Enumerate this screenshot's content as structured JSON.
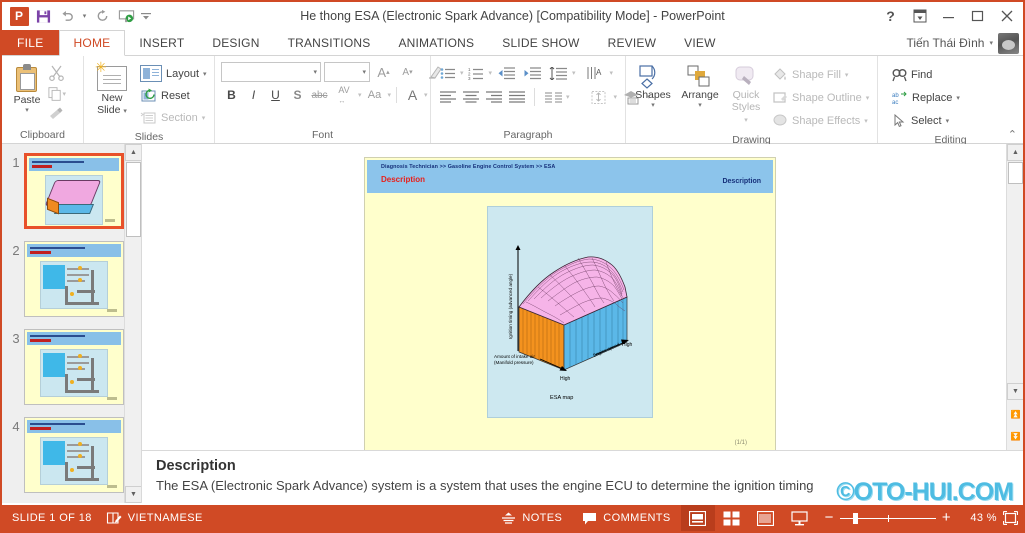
{
  "window": {
    "title": "He thong ESA (Electronic Spark Advance) [Compatibility Mode] - PowerPoint",
    "help_icon": "?",
    "ribbon_display_icon": "ribbon-display-options-icon",
    "minimize_icon": "minimize-icon",
    "restore_icon": "restore-icon",
    "close_icon": "close-icon"
  },
  "quick_access": {
    "app_logo": "powerpoint-logo",
    "save": "save-icon",
    "undo": "undo-icon",
    "redo": "redo-icon",
    "start_slideshow": "start-from-beginning-icon",
    "customize": "customize-quick-access-toolbar-icon"
  },
  "account": {
    "name": "Tiến Thái Đình",
    "caret": "▾"
  },
  "tabs": [
    {
      "label": "FILE",
      "active": false
    },
    {
      "label": "HOME",
      "active": true
    },
    {
      "label": "INSERT",
      "active": false
    },
    {
      "label": "DESIGN",
      "active": false
    },
    {
      "label": "TRANSITIONS",
      "active": false
    },
    {
      "label": "ANIMATIONS",
      "active": false
    },
    {
      "label": "SLIDE SHOW",
      "active": false
    },
    {
      "label": "REVIEW",
      "active": false
    },
    {
      "label": "VIEW",
      "active": false
    }
  ],
  "ribbon": {
    "groups": {
      "clipboard": {
        "label": "Clipboard",
        "paste": "Paste",
        "cut": "cut-icon",
        "copy": "copy-icon",
        "format_painter": "format-painter-icon"
      },
      "slides": {
        "label": "Slides",
        "new_slide": "New\nSlide",
        "new_slide_line1": "New",
        "new_slide_line2": "Slide",
        "layout": "Layout",
        "reset": "Reset",
        "section": "Section"
      },
      "font": {
        "label": "Font",
        "font_name_value": "",
        "font_size_value": "",
        "increase_size": "A",
        "decrease_size": "A",
        "clear_formatting": "clear-formatting-icon",
        "bold": "B",
        "italic": "I",
        "underline": "U",
        "shadow": "S",
        "strikethrough": "abc",
        "character_spacing": "AV",
        "change_case": "Aa",
        "font_color": "A"
      },
      "paragraph": {
        "label": "Paragraph",
        "bullets": "bullets-icon",
        "numbering": "numbering-icon",
        "decrease_indent": "decrease-indent-icon",
        "increase_indent": "increase-indent-icon",
        "line_spacing": "line-spacing-icon",
        "text_direction": "text-direction-icon",
        "align_text": "align-text-icon",
        "convert_smartart": "convert-to-smartart-icon",
        "align_left": "align-left-icon",
        "align_center": "align-center-icon",
        "align_right": "align-right-icon",
        "justify": "justify-icon",
        "columns": "columns-icon"
      },
      "drawing": {
        "label": "Drawing",
        "shapes": "Shapes",
        "arrange": "Arrange",
        "quick_styles_line1": "Quick",
        "quick_styles_line2": "Styles",
        "shape_fill": "Shape Fill",
        "shape_outline": "Shape Outline",
        "shape_effects": "Shape Effects"
      },
      "editing": {
        "label": "Editing",
        "find": "Find",
        "replace": "Replace",
        "select": "Select",
        "collapse_ribbon": "collapse-ribbon-icon"
      }
    }
  },
  "thumbnails": [
    {
      "number": "1",
      "selected": true,
      "kind": "surface"
    },
    {
      "number": "2",
      "selected": false,
      "kind": "flow"
    },
    {
      "number": "3",
      "selected": false,
      "kind": "flow"
    },
    {
      "number": "4",
      "selected": false,
      "kind": "flow"
    }
  ],
  "slide": {
    "breadcrumb": "Diagnosis Technician >> Gasoline Engine Control System >> ESA",
    "header_left": "Description",
    "header_right": "Description",
    "page_indicator": "(1/1)",
    "chart_caption": "ESA map",
    "y_axis_label": "Ignition timing (advanced angle)",
    "x_axis_label_line1": "Amount of intake air",
    "x_axis_label_line2": "(Manifold pressure)",
    "x_axis_high": "High",
    "z_axis_label": "Engine speed",
    "z_axis_high": "High"
  },
  "notes": {
    "title": "Description",
    "body": "The ESA (Electronic Spark Advance) system is a system that uses the engine ECU to determine the ignition timing",
    "watermark": "©OTO-HUI.COM"
  },
  "status": {
    "slide_counter": "SLIDE 1 OF 18",
    "proofing_icon": "spelling-and-grammar-icon",
    "language": "VIETNAMESE",
    "notes_label": "NOTES",
    "notes_icon": "notes-icon",
    "comments_label": "COMMENTS",
    "comments_icon": "comments-icon",
    "view_normal": "normal-view-icon",
    "view_sorter": "slide-sorter-view-icon",
    "view_reading": "reading-view-icon",
    "view_slideshow": "slide-show-view-icon",
    "zoom_out": "−",
    "zoom_in": "+",
    "zoom_level": "43 %",
    "fit_to_window": "fit-slide-to-window-icon"
  },
  "chart_data": {
    "type": "surface",
    "title": "ESA map",
    "xlabel": "Amount of intake air (Manifold pressure)",
    "ylabel": "Ignition timing (advanced angle)",
    "zlabel": "Engine speed",
    "x_tick_labels": [
      "High"
    ],
    "z_tick_labels": [
      "High"
    ],
    "grid": true,
    "legend": false,
    "surface_color": "#F6B4E8",
    "front_face_color": "#5BB8E8",
    "left_face_color": "#F4921E",
    "description": "3D surface map: ignition timing advance versus engine speed and amount of intake air (manifold pressure). Timing rises toward a plateau at mid-to-high engine speed and low-to-mid intake air, falling off at the highest intake air."
  }
}
